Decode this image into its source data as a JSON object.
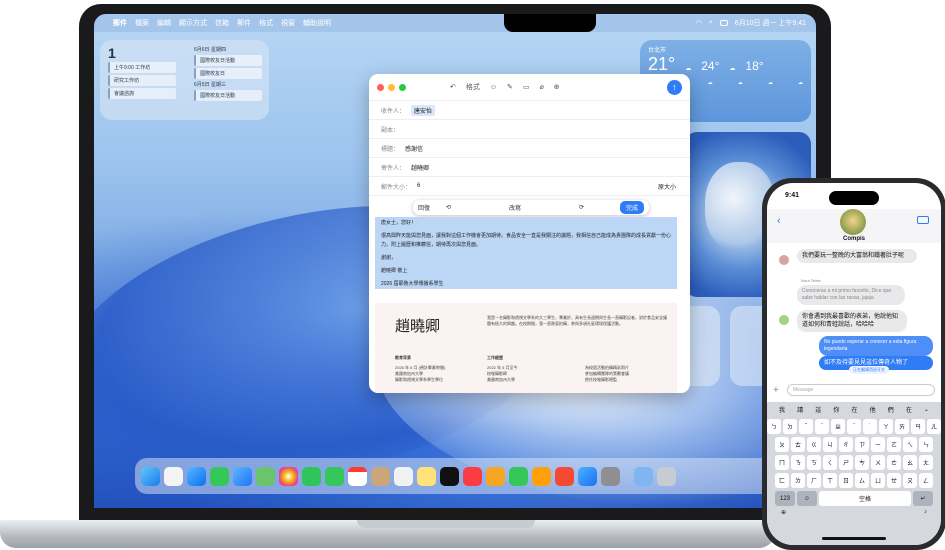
{
  "menubar": {
    "app": "郵件",
    "items": [
      "檔案",
      "編輯",
      "顯示方式",
      "信箱",
      "郵件",
      "格式",
      "視窗",
      "輔助說明"
    ],
    "date_time": "6月10日 週一 上午9:41"
  },
  "calendar_widget": {
    "day": "1",
    "events_left": [
      "上午9:00 工作坊",
      "研究工作坊",
      "會議諮詢",
      "自由"
    ],
    "col_header": "6月6日 星期四",
    "events_right": [
      "國際校友日活動",
      "國際校友日",
      "國際校友日活動"
    ],
    "col_header_2": "6月5日 星期三"
  },
  "weather_widget": {
    "city": "台北市",
    "temp_now": "21°",
    "temp_a": "24°",
    "temp_b": "18°",
    "days": [
      "上午7時",
      "上午8時",
      "上午9時",
      "上午10時",
      "上午11時",
      "中午"
    ]
  },
  "mail": {
    "toolbar": {
      "format_label": "格式"
    },
    "to_label": "收件人：",
    "to_value": "唐安怡",
    "cc_label": "副本：",
    "subject_label": "標題：",
    "subject_value": "感謝信",
    "from_label": "寄件人：",
    "from_value": "趙曉卿",
    "size_label": "郵件大小：",
    "size_value": "6",
    "size_dropdown": "原大小",
    "writing_tools": {
      "revert": "回復",
      "rewrite": "改寫",
      "done": "完成"
    },
    "body": [
      "唐女士，您好！",
      "很高興昨天能與您見面，讓我對這個工作機會更加期待。食品安全一直是我關注的議題，我相信自己能成為貴團隊的成長貢獻一份心力。附上履歷和推薦信，期待再次與您見面。",
      "謝謝，",
      "趙曉卿 敬上",
      "2026 屆耶魯大學傳播系學生"
    ],
    "resume": {
      "name": "趙曉卿",
      "edu_title": "教育背景",
      "edu_lines": [
        "2026 年 6 月 (預計畢業時間)",
        "美國南加州大學",
        "攝影和透視文學系學生學位"
      ],
      "work_title": "工作經歷",
      "work_lines": [
        "2022 年 5 月至今",
        "校報攝影師",
        "美國南加州大學"
      ],
      "bullets": [
        "為校園活動拍攝精彩照片",
        "參加編輯團隊的策劃會議",
        "擔任校報攝影總監"
      ],
      "intro": "我是一名攝影和透視文學系的大三學生，專業於，具有生長週期與生長一直攝影記者，對於食品安全議題有極大的興趣。在校期間，我一直熱衷拍攝，參與多項社區環境保護活動。"
    }
  },
  "phone": {
    "status_time": "9:41",
    "group_name": "Compis",
    "messages": [
      {
        "side": "in",
        "text": "我們要玩一整晚的大富翁和鐵著肚子呢"
      },
      {
        "sender": "Nora Tellez",
        "side": "in-muted",
        "text": "Conoceras a mi primo favorito, Dice que sabe hablar con las ranas, jajaja"
      },
      {
        "side": "in",
        "text": "你會遇到我最喜歡的表弟，他說他知道如何和青蛙說話，哈哈哈"
      },
      {
        "side": "out-muted",
        "text": "No puedo esperar a conocer a esta figura legendaria"
      },
      {
        "side": "out",
        "text": "如不及待要見見這位傳奇人物了"
      }
    ],
    "translate_status": "正在翻譯西班牙文",
    "input_placeholder": "Message",
    "kb": {
      "candidates": [
        "我",
        "請",
        "這",
        "你",
        "在",
        "他",
        "們",
        "在"
      ],
      "row1": [
        "ㄅ",
        "ㄉ",
        "ˇ",
        "ˋ",
        "ㄓ",
        "ˊ",
        "˙",
        "ㄚ",
        "ㄞ",
        "ㄢ",
        "ㄦ"
      ],
      "row2": [
        "ㄆ",
        "ㄊ",
        "ㄍ",
        "ㄐ",
        "ㄔ",
        "ㄗ",
        "ㄧ",
        "ㄛ",
        "ㄟ",
        "ㄣ"
      ],
      "row3": [
        "ㄇ",
        "ㄋ",
        "ㄎ",
        "ㄑ",
        "ㄕ",
        "ㄘ",
        "ㄨ",
        "ㄜ",
        "ㄠ",
        "ㄤ"
      ],
      "row4": [
        "ㄈ",
        "ㄌ",
        "ㄏ",
        "ㄒ",
        "ㄖ",
        "ㄙ",
        "ㄩ",
        "ㄝ",
        "ㄡ",
        "ㄥ"
      ],
      "num_key": "123",
      "space_key": "空格"
    }
  },
  "colors": {
    "accent": "#2f7cf6",
    "selection": "#bcd7f6",
    "bubble_out": "#2f7cf6",
    "bubble_in": "#e9e9eb"
  }
}
